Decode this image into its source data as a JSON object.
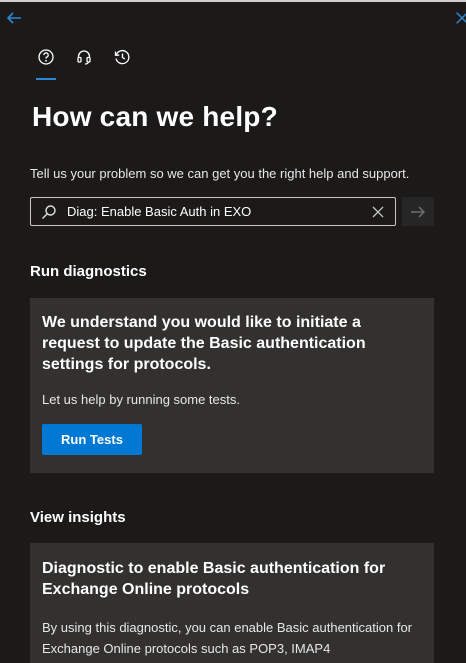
{
  "nav": {
    "back_icon": "back-arrow-icon",
    "close_icon": "close-icon"
  },
  "tabs": [
    {
      "name": "help-icon",
      "active": true
    },
    {
      "name": "headset-icon",
      "active": false
    },
    {
      "name": "history-icon",
      "active": false
    }
  ],
  "header": {
    "title": "How can we help?"
  },
  "search": {
    "description": "Tell us your problem so we can get you the right help and support.",
    "value": "Diag: Enable Basic Auth in EXO"
  },
  "diagnostics": {
    "section_title": "Run diagnostics",
    "card_title": "We understand you would like to initiate a request to update the Basic authentication settings for protocols.",
    "card_text": "Let us help by running some tests.",
    "button_label": "Run Tests"
  },
  "insights": {
    "section_title": "View insights",
    "card_title": "Diagnostic to enable Basic authentication for Exchange Online protocols",
    "card_text": "By using this diagnostic, you can enable Basic authentication for Exchange Online protocols such as POP3, IMAP4"
  },
  "colors": {
    "accent": "#0078d4",
    "background": "#1b1a19",
    "card": "#323130"
  }
}
